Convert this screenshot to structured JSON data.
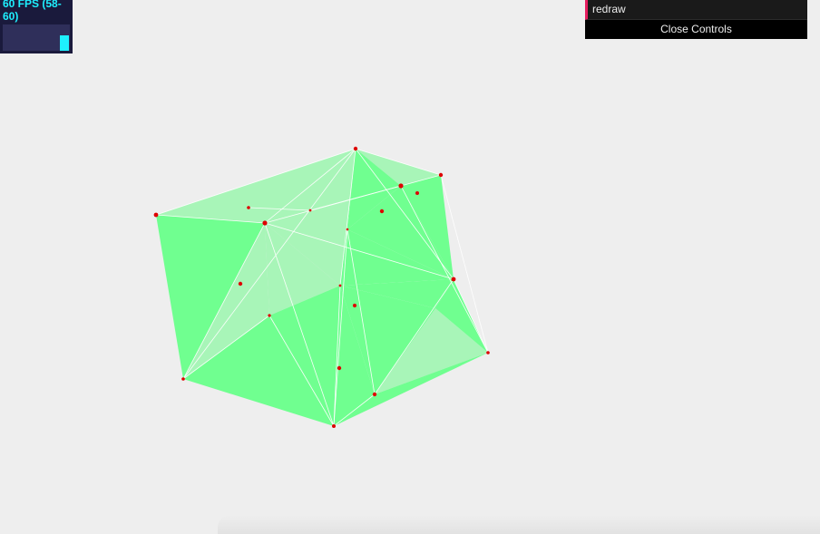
{
  "stats": {
    "fps_text": "60 FPS (58-60)",
    "fps_current": 60,
    "fps_min": 58,
    "fps_max": 60,
    "text_color": "#1ef0ff",
    "background_color": "#1a1a3c"
  },
  "controls": {
    "items": [
      {
        "label": "redraw",
        "type": "function"
      }
    ],
    "close_label": "Close Controls",
    "accent_color": "#e61d5f"
  },
  "scene": {
    "description_colors": {
      "face_front": "#70ff90",
      "face_back": "#a8f5b8",
      "vertex": "#dd0000",
      "edge": "#ffffff",
      "background": "#eeeeee"
    }
  }
}
